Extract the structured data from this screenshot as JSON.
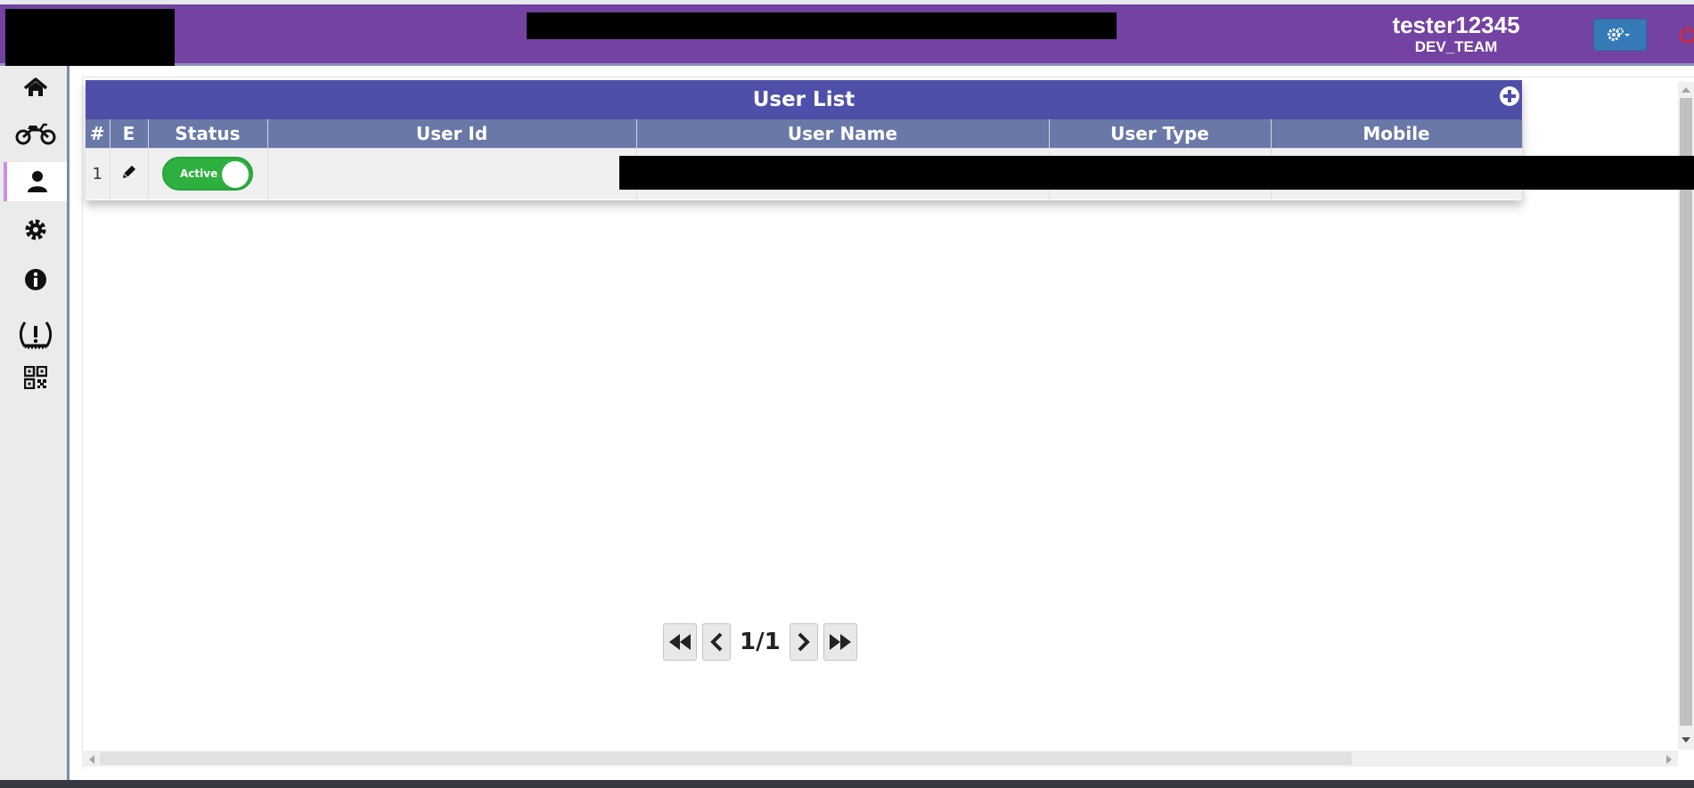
{
  "header": {
    "user_name": "tester12345",
    "team": "DEV_TEAM",
    "accent_color": "#7342a2"
  },
  "sidebar": {
    "items": [
      {
        "id": "home",
        "icon": "home-icon"
      },
      {
        "id": "vehicles",
        "icon": "motorcycle-icon"
      },
      {
        "id": "users",
        "icon": "user-icon",
        "active": true
      },
      {
        "id": "settings",
        "icon": "gear-icon"
      },
      {
        "id": "info",
        "icon": "info-icon"
      },
      {
        "id": "tire-alert",
        "icon": "tire-pressure-alert-icon"
      },
      {
        "id": "qr",
        "icon": "qr-code-icon"
      }
    ]
  },
  "panel": {
    "title": "User List",
    "columns": [
      "#",
      "E",
      "Status",
      "User Id",
      "User Name",
      "User Type",
      "Mobile"
    ],
    "rows": [
      {
        "index": "1",
        "status": "Active"
      }
    ]
  },
  "pagination": {
    "text": "1/1"
  }
}
